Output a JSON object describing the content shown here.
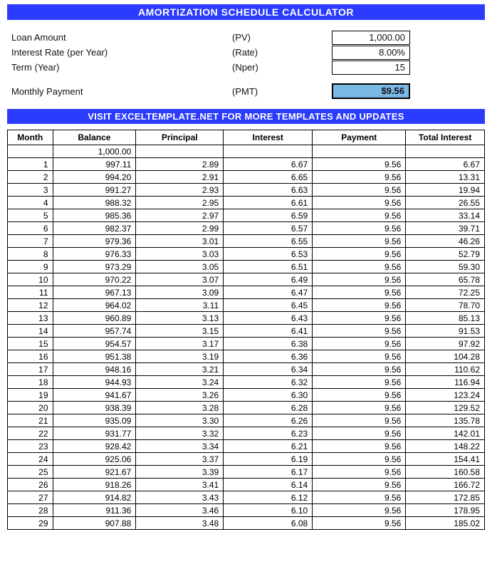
{
  "banner_title": "AMORTIZATION SCHEDULE CALCULATOR",
  "inputs": {
    "loan_amount_label": "Loan Amount",
    "loan_amount_sym": "(PV)",
    "loan_amount_val": "1,000.00",
    "rate_label": "Interest Rate (per Year)",
    "rate_sym": "(Rate)",
    "rate_val": "8.00%",
    "term_label": "Term (Year)",
    "term_sym": "(Nper)",
    "term_val": "15",
    "pmt_label": "Monthly Payment",
    "pmt_sym": "(PMT)",
    "pmt_val": "$9.56"
  },
  "banner_link": "VISIT EXCELTEMPLATE.NET FOR MORE TEMPLATES AND UPDATES",
  "table": {
    "headers": [
      "Month",
      "Balance",
      "Principal",
      "Interest",
      "Payment",
      "Total Interest"
    ],
    "initial_balance": "1,000.00",
    "rows": [
      {
        "month": "1",
        "balance": "997.11",
        "principal": "2.89",
        "interest": "6.67",
        "payment": "9.56",
        "totint": "6.67"
      },
      {
        "month": "2",
        "balance": "994.20",
        "principal": "2.91",
        "interest": "6.65",
        "payment": "9.56",
        "totint": "13.31"
      },
      {
        "month": "3",
        "balance": "991.27",
        "principal": "2.93",
        "interest": "6.63",
        "payment": "9.56",
        "totint": "19.94"
      },
      {
        "month": "4",
        "balance": "988.32",
        "principal": "2.95",
        "interest": "6.61",
        "payment": "9.56",
        "totint": "26.55"
      },
      {
        "month": "5",
        "balance": "985.36",
        "principal": "2.97",
        "interest": "6.59",
        "payment": "9.56",
        "totint": "33.14"
      },
      {
        "month": "6",
        "balance": "982.37",
        "principal": "2.99",
        "interest": "6.57",
        "payment": "9.56",
        "totint": "39.71"
      },
      {
        "month": "7",
        "balance": "979.36",
        "principal": "3.01",
        "interest": "6.55",
        "payment": "9.56",
        "totint": "46.26"
      },
      {
        "month": "8",
        "balance": "976.33",
        "principal": "3.03",
        "interest": "6.53",
        "payment": "9.56",
        "totint": "52.79"
      },
      {
        "month": "9",
        "balance": "973.29",
        "principal": "3.05",
        "interest": "6.51",
        "payment": "9.56",
        "totint": "59.30"
      },
      {
        "month": "10",
        "balance": "970.22",
        "principal": "3.07",
        "interest": "6.49",
        "payment": "9.56",
        "totint": "65.78"
      },
      {
        "month": "11",
        "balance": "967.13",
        "principal": "3.09",
        "interest": "6.47",
        "payment": "9.56",
        "totint": "72.25"
      },
      {
        "month": "12",
        "balance": "964.02",
        "principal": "3.11",
        "interest": "6.45",
        "payment": "9.56",
        "totint": "78.70"
      },
      {
        "month": "13",
        "balance": "960.89",
        "principal": "3.13",
        "interest": "6.43",
        "payment": "9.56",
        "totint": "85.13"
      },
      {
        "month": "14",
        "balance": "957.74",
        "principal": "3.15",
        "interest": "6.41",
        "payment": "9.56",
        "totint": "91.53"
      },
      {
        "month": "15",
        "balance": "954.57",
        "principal": "3.17",
        "interest": "6.38",
        "payment": "9.56",
        "totint": "97.92"
      },
      {
        "month": "16",
        "balance": "951.38",
        "principal": "3.19",
        "interest": "6.36",
        "payment": "9.56",
        "totint": "104.28"
      },
      {
        "month": "17",
        "balance": "948.16",
        "principal": "3.21",
        "interest": "6.34",
        "payment": "9.56",
        "totint": "110.62"
      },
      {
        "month": "18",
        "balance": "944.93",
        "principal": "3.24",
        "interest": "6.32",
        "payment": "9.56",
        "totint": "116.94"
      },
      {
        "month": "19",
        "balance": "941.67",
        "principal": "3.26",
        "interest": "6.30",
        "payment": "9.56",
        "totint": "123.24"
      },
      {
        "month": "20",
        "balance": "938.39",
        "principal": "3.28",
        "interest": "6.28",
        "payment": "9.56",
        "totint": "129.52"
      },
      {
        "month": "21",
        "balance": "935.09",
        "principal": "3.30",
        "interest": "6.26",
        "payment": "9.56",
        "totint": "135.78"
      },
      {
        "month": "22",
        "balance": "931.77",
        "principal": "3.32",
        "interest": "6.23",
        "payment": "9.56",
        "totint": "142.01"
      },
      {
        "month": "23",
        "balance": "928.42",
        "principal": "3.34",
        "interest": "6.21",
        "payment": "9.56",
        "totint": "148.22"
      },
      {
        "month": "24",
        "balance": "925.06",
        "principal": "3.37",
        "interest": "6.19",
        "payment": "9.56",
        "totint": "154.41"
      },
      {
        "month": "25",
        "balance": "921.67",
        "principal": "3.39",
        "interest": "6.17",
        "payment": "9.56",
        "totint": "160.58"
      },
      {
        "month": "26",
        "balance": "918.26",
        "principal": "3.41",
        "interest": "6.14",
        "payment": "9.56",
        "totint": "166.72"
      },
      {
        "month": "27",
        "balance": "914.82",
        "principal": "3.43",
        "interest": "6.12",
        "payment": "9.56",
        "totint": "172.85"
      },
      {
        "month": "28",
        "balance": "911.36",
        "principal": "3.46",
        "interest": "6.10",
        "payment": "9.56",
        "totint": "178.95"
      },
      {
        "month": "29",
        "balance": "907.88",
        "principal": "3.48",
        "interest": "6.08",
        "payment": "9.56",
        "totint": "185.02"
      }
    ]
  }
}
